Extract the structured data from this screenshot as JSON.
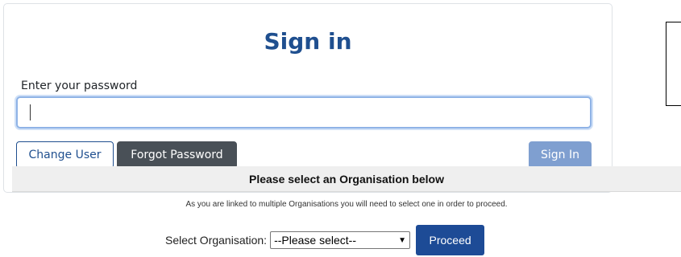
{
  "signin": {
    "title": "Sign in",
    "password_label": "Enter your password",
    "password_value": "",
    "change_user_label": "Change User",
    "forgot_password_label": "Forgot Password",
    "sign_in_label": "Sign In"
  },
  "organisation": {
    "header": "Please select an Organisation below",
    "note": "As you are linked to multiple Organisations you will need to select one in order to proceed.",
    "select_label": "Select Organisation:",
    "select_value": "--Please select--",
    "proceed_label": "Proceed"
  }
}
